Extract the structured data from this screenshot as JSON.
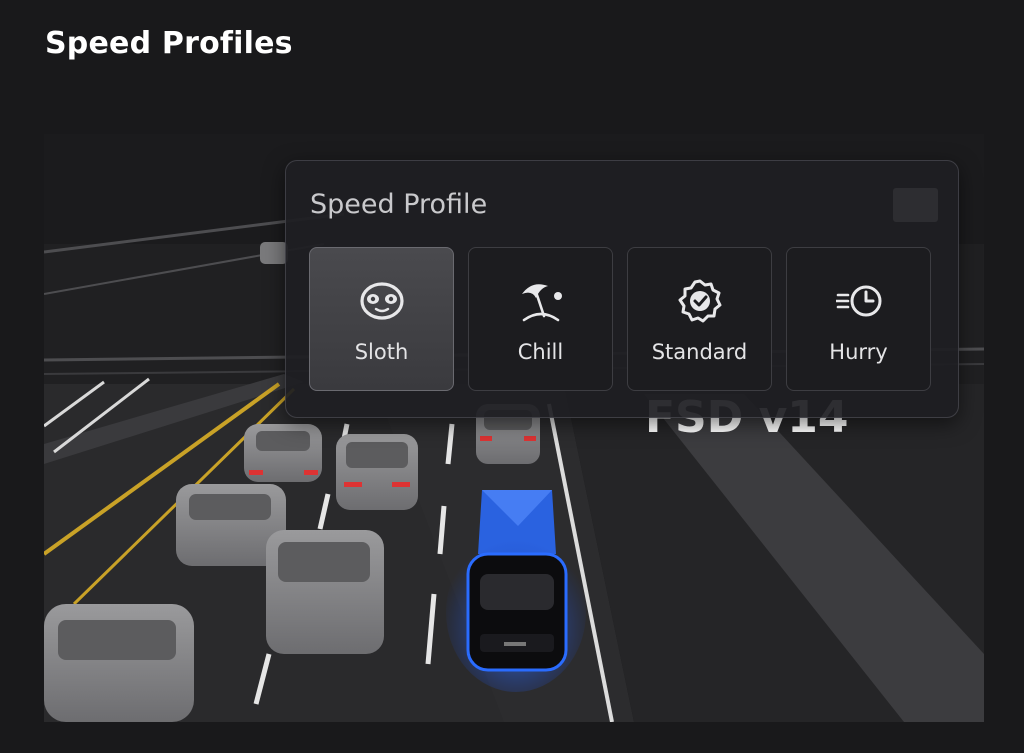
{
  "page": {
    "title": "Speed Profiles"
  },
  "panel": {
    "title": "Speed Profile",
    "selected": "Sloth",
    "options": [
      {
        "label": "Sloth",
        "icon": "sloth-icon"
      },
      {
        "label": "Chill",
        "icon": "beach-umbrella-icon"
      },
      {
        "label": "Standard",
        "icon": "badge-check-icon"
      },
      {
        "label": "Hurry",
        "icon": "fast-clock-icon"
      }
    ]
  },
  "overlay": {
    "watermark": "FSD v14"
  },
  "colors": {
    "background": "#19191b",
    "accent_blue": "#2a6cff",
    "lane_yellow": "#c9a227"
  }
}
